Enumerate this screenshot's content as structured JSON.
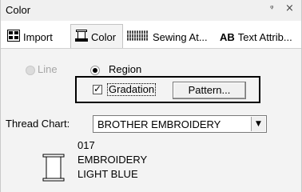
{
  "window": {
    "title": "Color",
    "pin_icon": "pin-icon",
    "close_icon": "close-icon"
  },
  "tabs": [
    {
      "label": "Import",
      "icon": "import-icon",
      "active": false
    },
    {
      "label": "Color",
      "icon": "color-icon",
      "active": true
    },
    {
      "label": "Sewing At...",
      "icon": "sewing-attributes-icon",
      "active": false
    },
    {
      "label": "Text Attrib...",
      "icon": "text-attributes-icon",
      "icon_text": "AB",
      "active": false
    }
  ],
  "mode": {
    "line_label": "Line",
    "line_enabled": false,
    "region_label": "Region",
    "region_selected": true
  },
  "gradation": {
    "label": "Gradation",
    "checked": true,
    "check_glyph": "✓",
    "pattern_button": "Pattern..."
  },
  "thread_chart": {
    "label": "Thread Chart:",
    "value": "BROTHER EMBROIDERY",
    "arrow": "▼"
  },
  "thread": {
    "number": "017",
    "line1": "EMBROIDERY",
    "line2": "LIGHT BLUE",
    "spool_icon": "thread-spool-icon"
  }
}
